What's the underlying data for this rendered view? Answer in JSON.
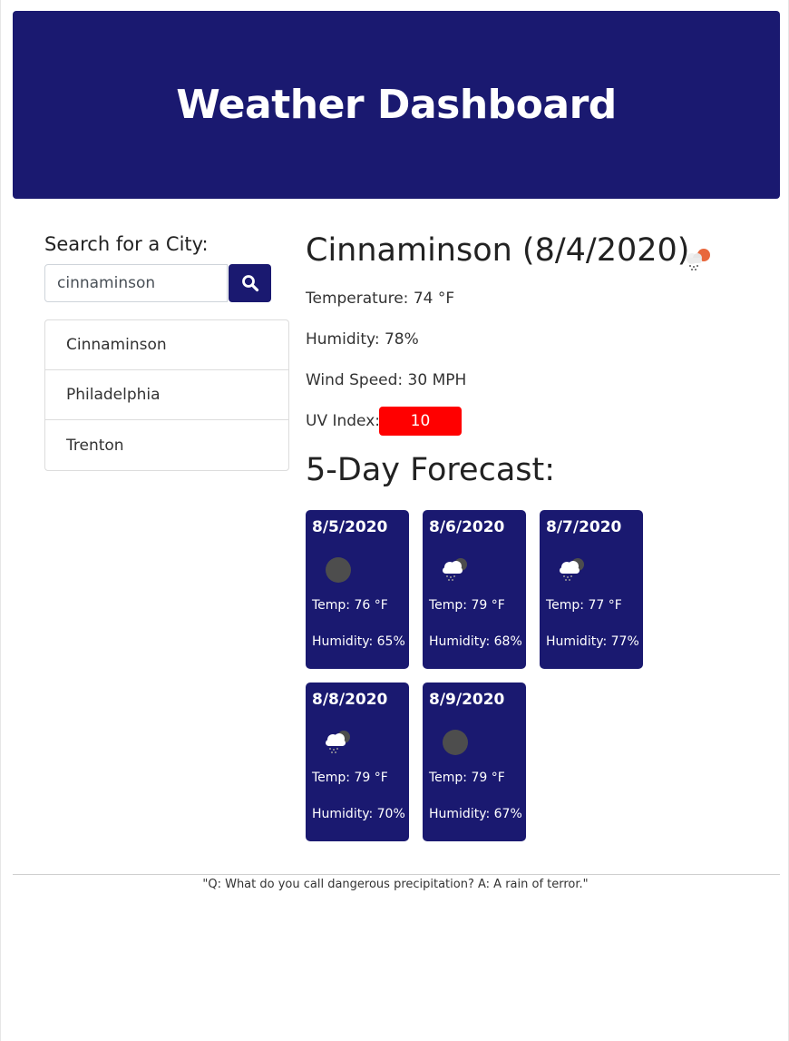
{
  "header": {
    "title": "Weather Dashboard"
  },
  "search": {
    "label": "Search for a City:",
    "value": "cinnaminson",
    "button_icon": "search-icon",
    "history": [
      "Cinnaminson",
      "Philadelphia",
      "Trenton"
    ]
  },
  "current": {
    "title": "Cinnaminson (8/4/2020)",
    "icon": "light-rain-sun-icon",
    "temperature": "Temperature: 74 °F",
    "humidity": "Humidity: 78%",
    "wind": "Wind Speed: 30 MPH",
    "uv_label": "UV Index:",
    "uv_value": "10",
    "uv_color": "#ff0000"
  },
  "forecast": {
    "title": "5-Day Forecast:",
    "days": [
      {
        "date": "8/5/2020",
        "icon": "clear-night-icon",
        "temp": "Temp: 76 °F",
        "humidity": "Humidity: 65%"
      },
      {
        "date": "8/6/2020",
        "icon": "rain-cloud-icon",
        "temp": "Temp: 79 °F",
        "humidity": "Humidity: 68%"
      },
      {
        "date": "8/7/2020",
        "icon": "rain-cloud-icon",
        "temp": "Temp: 77 °F",
        "humidity": "Humidity: 77%"
      },
      {
        "date": "8/8/2020",
        "icon": "rain-cloud-icon",
        "temp": "Temp: 79 °F",
        "humidity": "Humidity: 70%"
      },
      {
        "date": "8/9/2020",
        "icon": "clear-night-icon",
        "temp": "Temp: 79 °F",
        "humidity": "Humidity: 67%"
      }
    ]
  },
  "footer": {
    "quote": "\"Q: What do you call dangerous precipitation? A: A rain of terror.\""
  },
  "colors": {
    "brand": "#1a1970",
    "uv_high": "#ff0000"
  }
}
